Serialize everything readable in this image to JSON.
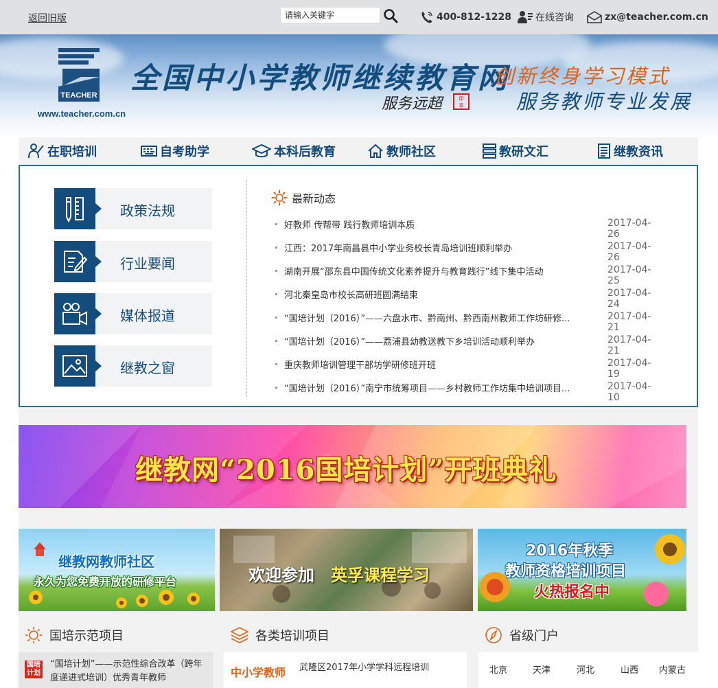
{
  "topbar": {
    "back_label": "返回旧版",
    "search_placeholder": "请输入关键字",
    "phone": "400-812-1228",
    "consult": "在线咨询",
    "email": "zx@teacher.com.cn"
  },
  "header": {
    "logo_url": "www.teacher.com.cn",
    "logo_text": "TEACHER",
    "site_title": "全国中小学教师继续教育网",
    "signature": "服务远超",
    "slogan_line1": "创新终身学习模式",
    "slogan_line2": "服务教师专业发展"
  },
  "nav": {
    "items": [
      {
        "label": "在职培训",
        "icon": "teacher-icon"
      },
      {
        "label": "自考助学",
        "icon": "keyboard-icon"
      },
      {
        "label": "本科后教育",
        "icon": "graduation-cap-icon"
      },
      {
        "label": "教师社区",
        "icon": "home-icon"
      },
      {
        "label": "教研文汇",
        "icon": "server-icon"
      },
      {
        "label": "继教资讯",
        "icon": "document-icon"
      }
    ]
  },
  "categories": [
    {
      "label": "政策法规",
      "icon": "ruler-pencil-icon"
    },
    {
      "label": "行业要闻",
      "icon": "edit-document-icon"
    },
    {
      "label": "媒体报道",
      "icon": "video-camera-icon"
    },
    {
      "label": "继教之窗",
      "icon": "picture-icon"
    }
  ],
  "news": {
    "heading": "最新动态",
    "items": [
      {
        "title": "好教师 传帮带 践行教师培训本质",
        "date": "2017-04-26"
      },
      {
        "title": "江西：2017年南昌县中小学业务校长青岛培训班顺利举办",
        "date": "2017-04-26"
      },
      {
        "title": "湖南开展“邵东县中国传统文化素养提升与教育践行”线下集中活动",
        "date": "2017-04-25"
      },
      {
        "title": "河北秦皇岛市校长高研班圆满结束",
        "date": "2017-04-24"
      },
      {
        "title": "“国培计划（2016）”——六盘水市、黔南州、黔西南州教师工作坊研修...",
        "date": "2017-04-21"
      },
      {
        "title": "“国培计划（2016）”——荔浦县幼教送教下乡培训活动顺利举办",
        "date": "2017-04-21"
      },
      {
        "title": "重庆教师培训管理干部坊学研修班开班",
        "date": "2017-04-19"
      },
      {
        "title": "“国培计划（2016）”南宁市统筹项目——乡村教师工作坊集中培训项目...",
        "date": "2017-04-10"
      }
    ]
  },
  "big_banner": {
    "text": "继教网“2016国培计划”开班典礼"
  },
  "promos": {
    "p1_line1": "继教网教师社区",
    "p1_line2": "永久为您免费开放的研修平台",
    "p2_line1": "欢迎参加",
    "p2_line2": "英孚课程学习",
    "p3_line1": "2016年秋季",
    "p3_line2": "教师资格培训项目",
    "p3_line3": "火热报名中"
  },
  "sections": {
    "guopei": {
      "title": "国培示范项目",
      "badge": "国培计划",
      "item": "“国培计划”——示范性综合改革（跨年度递进式培训）优秀青年教师"
    },
    "training": {
      "title": "各类培训项目",
      "category": "中小学教师",
      "item": "武隆区2017年小学学科远程培训"
    },
    "provinces": {
      "title": "省级门户",
      "items": [
        "北京",
        "天津",
        "河北",
        "山西",
        "内蒙古"
      ]
    }
  },
  "colors": {
    "primary": "#134d7e",
    "accent": "#e06418",
    "topbar_bg": "#dfe1e3"
  }
}
